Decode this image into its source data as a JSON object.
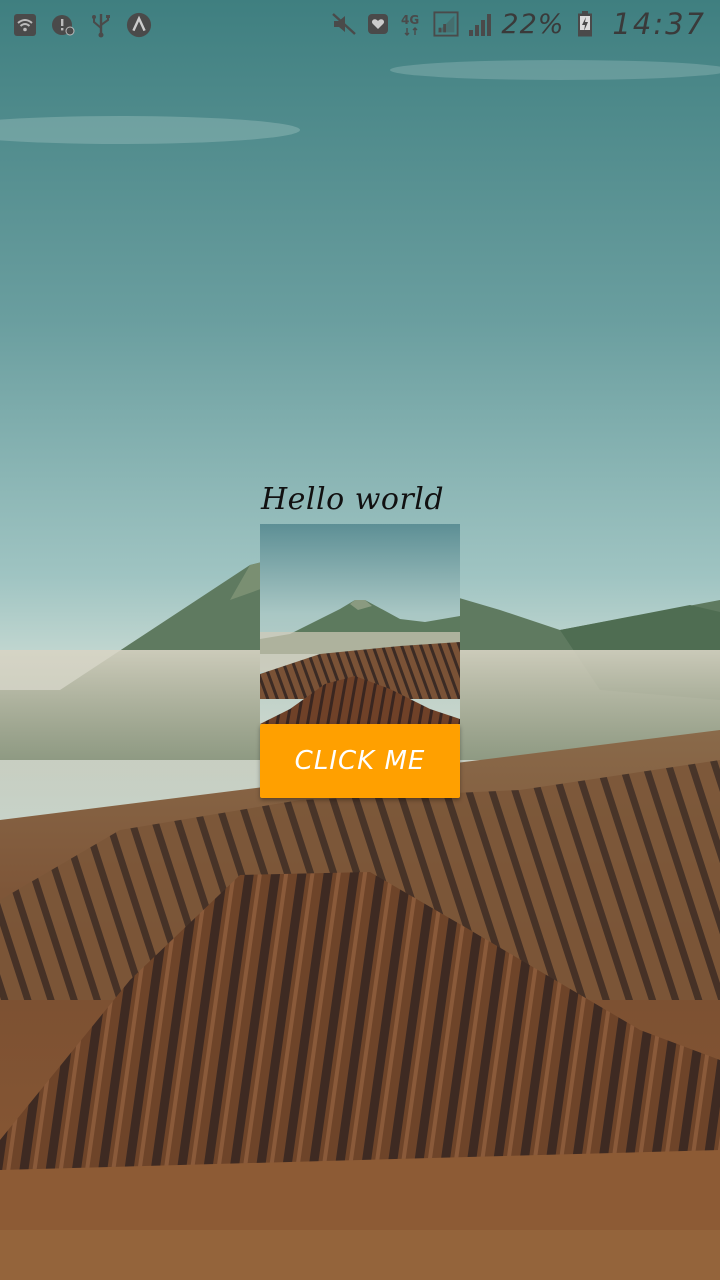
{
  "status_bar": {
    "battery_percent": "22%",
    "time": "14:37",
    "network_type": "4G",
    "icons_left": [
      "wifi-icon",
      "alert-icon",
      "usb-icon",
      "android-studio-icon"
    ],
    "icons_right": [
      "mute-icon",
      "heart-shield-icon",
      "network-4g-icon",
      "signal-box-icon",
      "signal-icon",
      "battery-charging-icon"
    ]
  },
  "main": {
    "greeting": "Hello world",
    "button_label": "CLICK ME",
    "image_icon": "mountain-image"
  },
  "colors": {
    "button": "#ffa000",
    "button_text": "#ffffff",
    "greeting_text": "#111111",
    "status_text": "#3a3a3a"
  }
}
